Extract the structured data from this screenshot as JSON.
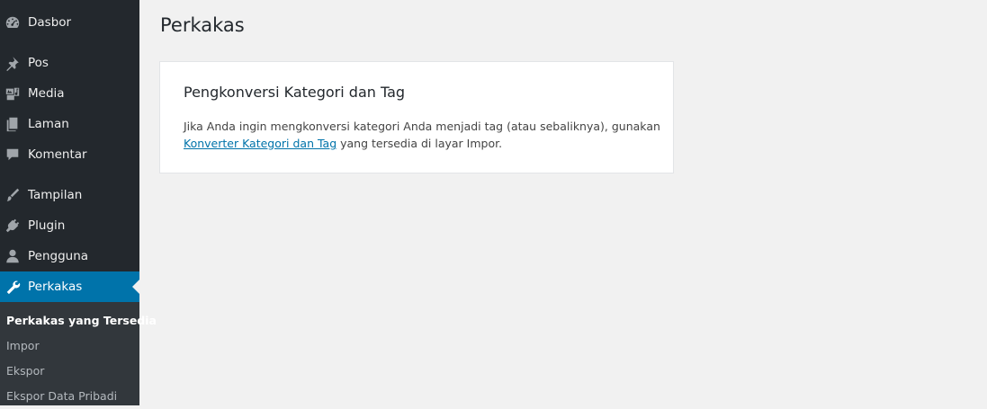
{
  "sidebar": {
    "items": [
      {
        "label": "Dasbor",
        "icon": "dashboard-icon"
      },
      {
        "label": "Pos",
        "icon": "pin-icon"
      },
      {
        "label": "Media",
        "icon": "media-icon"
      },
      {
        "label": "Laman",
        "icon": "pages-icon"
      },
      {
        "label": "Komentar",
        "icon": "comment-icon"
      },
      {
        "label": "Tampilan",
        "icon": "brush-icon"
      },
      {
        "label": "Plugin",
        "icon": "plug-icon"
      },
      {
        "label": "Pengguna",
        "icon": "user-icon"
      },
      {
        "label": "Perkakas",
        "icon": "wrench-icon",
        "current": true
      }
    ],
    "submenu": [
      {
        "label": "Perkakas yang Tersedia",
        "active": true
      },
      {
        "label": "Impor"
      },
      {
        "label": "Ekspor"
      },
      {
        "label": "Ekspor Data Pribadi"
      }
    ]
  },
  "main": {
    "title": "Perkakas",
    "card": {
      "title": "Pengkonversi Kategori dan Tag",
      "desc_before": "Jika Anda ingin mengkonversi kategori Anda menjadi tag (atau sebaliknya), gunakan ",
      "link_text": "Konverter Kategori dan Tag",
      "desc_after": " yang tersedia di layar Impor."
    }
  },
  "colors": {
    "sidebar_bg": "#23282d",
    "submenu_bg": "#32373c",
    "accent": "#0073aa",
    "page_bg": "#f1f1f1"
  }
}
